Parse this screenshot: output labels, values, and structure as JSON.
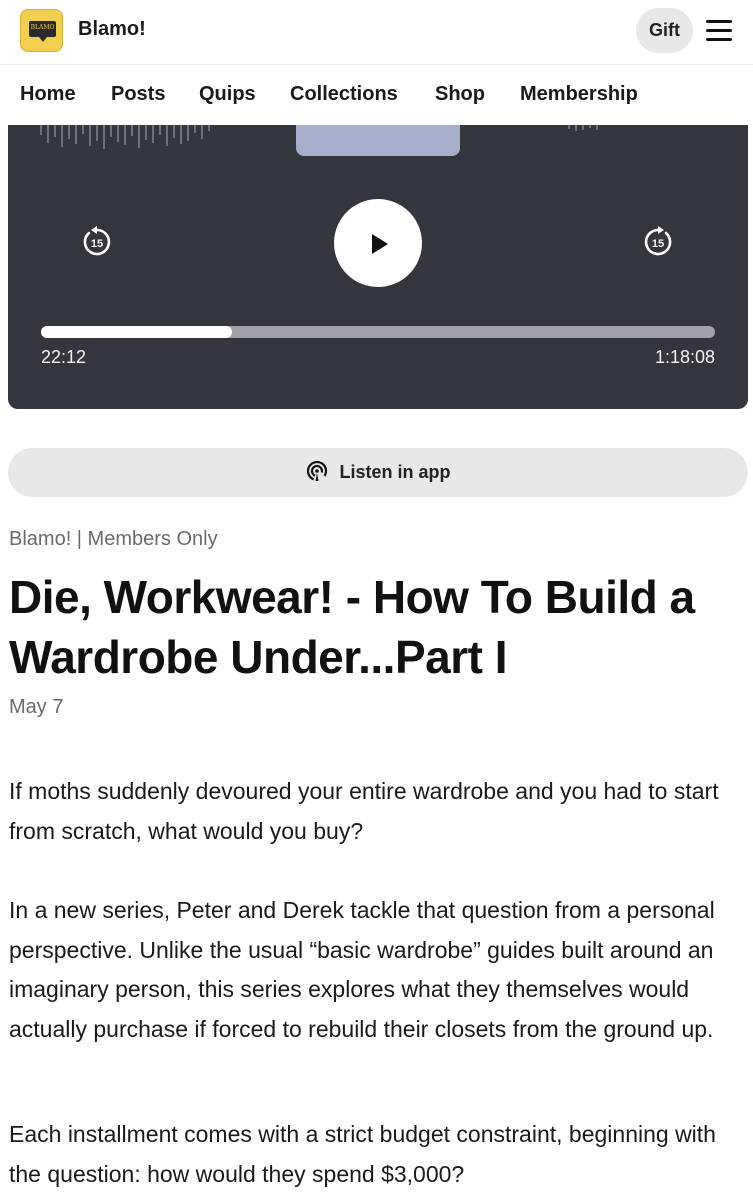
{
  "header": {
    "logo_text": "BLAMO",
    "site_name": "Blamo!",
    "gift_label": "Gift"
  },
  "nav": {
    "items": [
      {
        "label": "Home"
      },
      {
        "label": "Posts"
      },
      {
        "label": "Quips"
      },
      {
        "label": "Collections"
      },
      {
        "label": "Shop"
      },
      {
        "label": "Membership"
      }
    ]
  },
  "player": {
    "skip_back_seconds": "15",
    "skip_forward_seconds": "15",
    "elapsed": "22:12",
    "duration": "1:18:08",
    "progress_fraction": 0.284,
    "colors": {
      "background": "#34363d",
      "track": "#9fa1a6",
      "fill": "#ffffff"
    }
  },
  "listen": {
    "label": "Listen in app",
    "icon": "podcast-icon"
  },
  "article": {
    "meta": "Blamo! | Members Only",
    "title": "Die, Workwear! - How To Build a Wardrobe Under...Part I",
    "date": "May 7",
    "paragraphs": [
      "If moths suddenly devoured your entire wardrobe and you had to start from scratch, what would you buy?",
      "In a new series, Peter and Derek tackle that question from a personal perspective. Unlike the usual “basic wardrobe” guides built around an imaginary person, this series explores what they themselves would actually purchase if forced to rebuild their closets from the ground up.",
      "Each installment comes with a strict budget constraint, beginning with the question: how would they spend $3,000?"
    ]
  }
}
